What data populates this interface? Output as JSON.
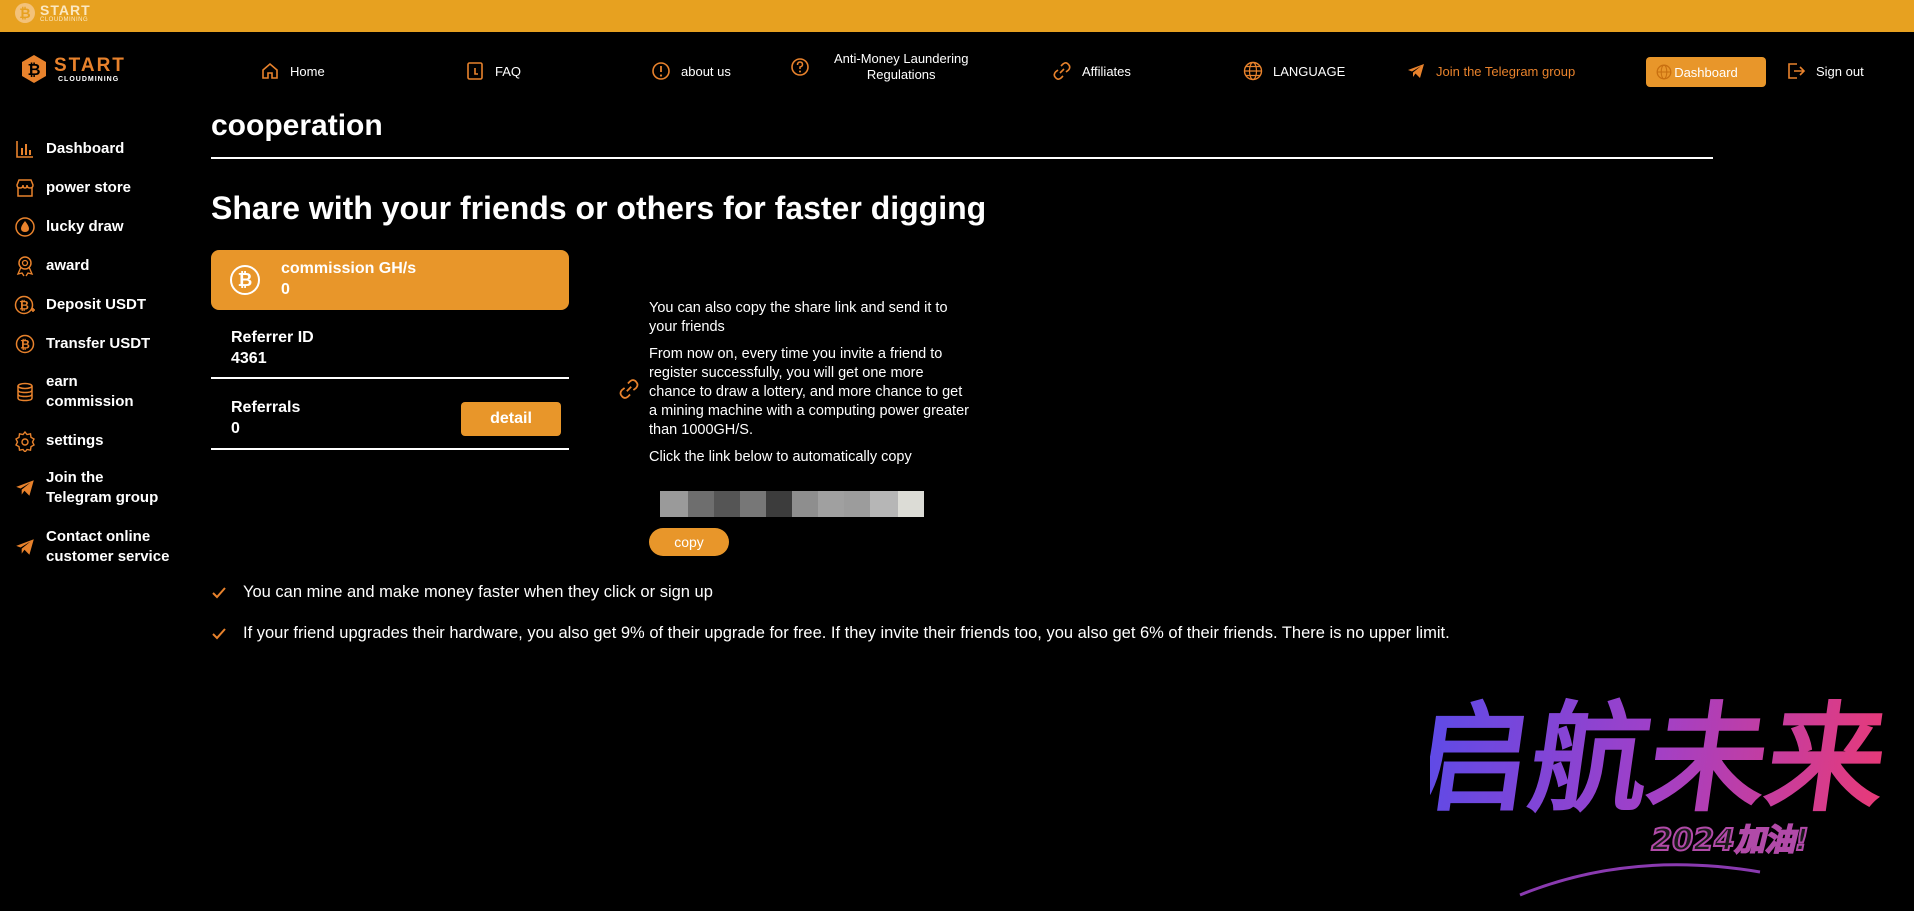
{
  "top_strip": {
    "brand": "START",
    "sub": "CLOUDMINING"
  },
  "logo": {
    "brand": "START",
    "sub": "CLOUDMINING"
  },
  "nav": {
    "home": "Home",
    "faq": "FAQ",
    "about": "about us",
    "aml_line1": "Anti-Money Laundering",
    "aml_line2": "Regulations",
    "affiliates": "Affiliates",
    "language": "LANGUAGE",
    "telegram": "Join the Telegram group",
    "dashboard": "Dashboard",
    "signout": "Sign out"
  },
  "sidebar": {
    "items": [
      {
        "label": "Dashboard",
        "icon": "chart-bars-icon"
      },
      {
        "label": "power store",
        "icon": "store-icon"
      },
      {
        "label": "lucky draw",
        "icon": "drop-icon"
      },
      {
        "label": "award",
        "icon": "medal-icon"
      },
      {
        "label": "Deposit USDT",
        "icon": "bitcoin-plus-icon"
      },
      {
        "label": "Transfer USDT",
        "icon": "bitcoin-icon"
      },
      {
        "label_line1": "earn",
        "label_line2": "commission",
        "icon": "database-icon"
      },
      {
        "label": "settings",
        "icon": "gear-icon"
      },
      {
        "label_line1": "Join the",
        "label_line2": "Telegram group",
        "icon": "telegram-icon"
      },
      {
        "label_line1": "Contact online",
        "label_line2": "customer service",
        "icon": "telegram-icon"
      }
    ]
  },
  "main": {
    "title": "cooperation",
    "headline": "Share with your friends or others for faster digging",
    "commission": {
      "label": "commission GH/s",
      "value": "0"
    },
    "referrer": {
      "label": "Referrer ID",
      "value": "4361"
    },
    "referrals": {
      "label": "Referrals",
      "value": "0",
      "button": "detail"
    },
    "share": {
      "p1": "You can also copy the share link and send it to your friends",
      "p2": "From now on, every time you invite a friend to register successfully, you will get one more chance to draw a lottery, and more chance to get a mining machine with a computing power greater than 1000GH/S.",
      "p3": "Click the link below to automatically copy",
      "copy": "copy"
    },
    "benefits": [
      "You can mine and make money faster when they click or sign up",
      "If your friend upgrades their hardware, you also get 9% of their upgrade for free. If they invite their friends too, you also get 6% of their friends. There is no upper limit."
    ]
  },
  "badge": {
    "text": "启航未来",
    "sub": "2024加油!"
  },
  "colors": {
    "accent": "#E8962A",
    "strip": "#E7A120",
    "brand_orange": "#E8822C",
    "background": "#000000"
  }
}
